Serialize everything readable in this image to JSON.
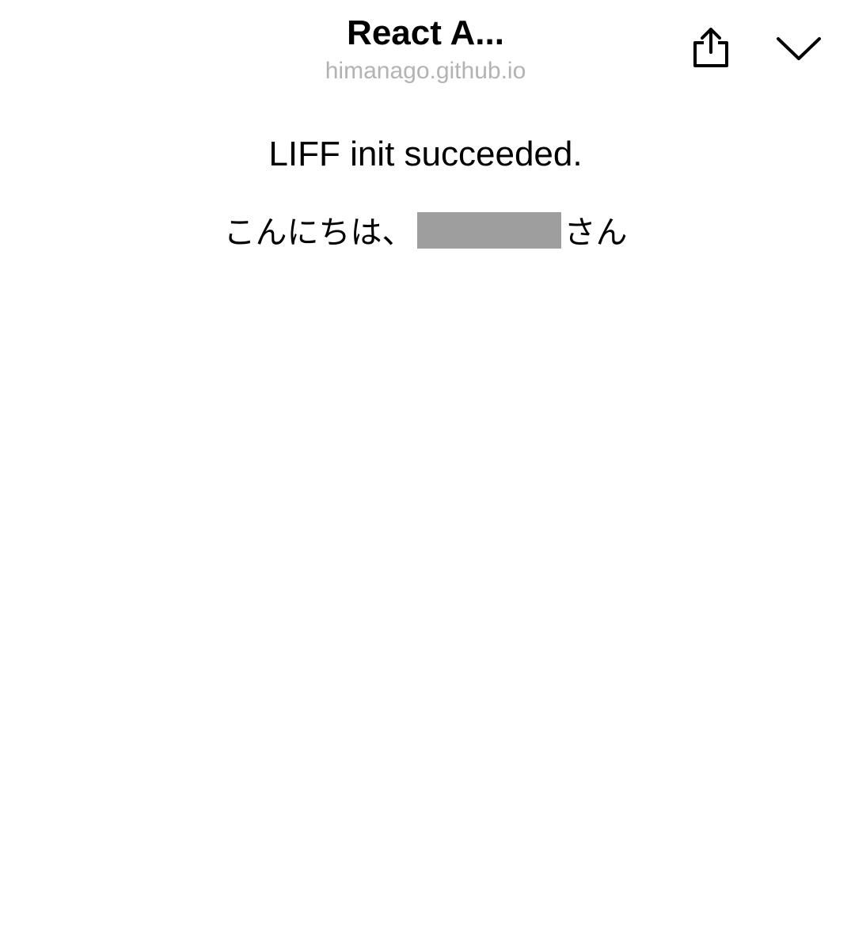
{
  "header": {
    "title": "React A...",
    "domain": "himanago.github.io",
    "share_icon": "share-icon",
    "close_icon": "chevron-down-icon"
  },
  "main": {
    "status_text": "LIFF init succeeded.",
    "greeting_prefix": "こんにちは、",
    "greeting_suffix": "さん",
    "redacted_color": "#9e9e9e"
  }
}
